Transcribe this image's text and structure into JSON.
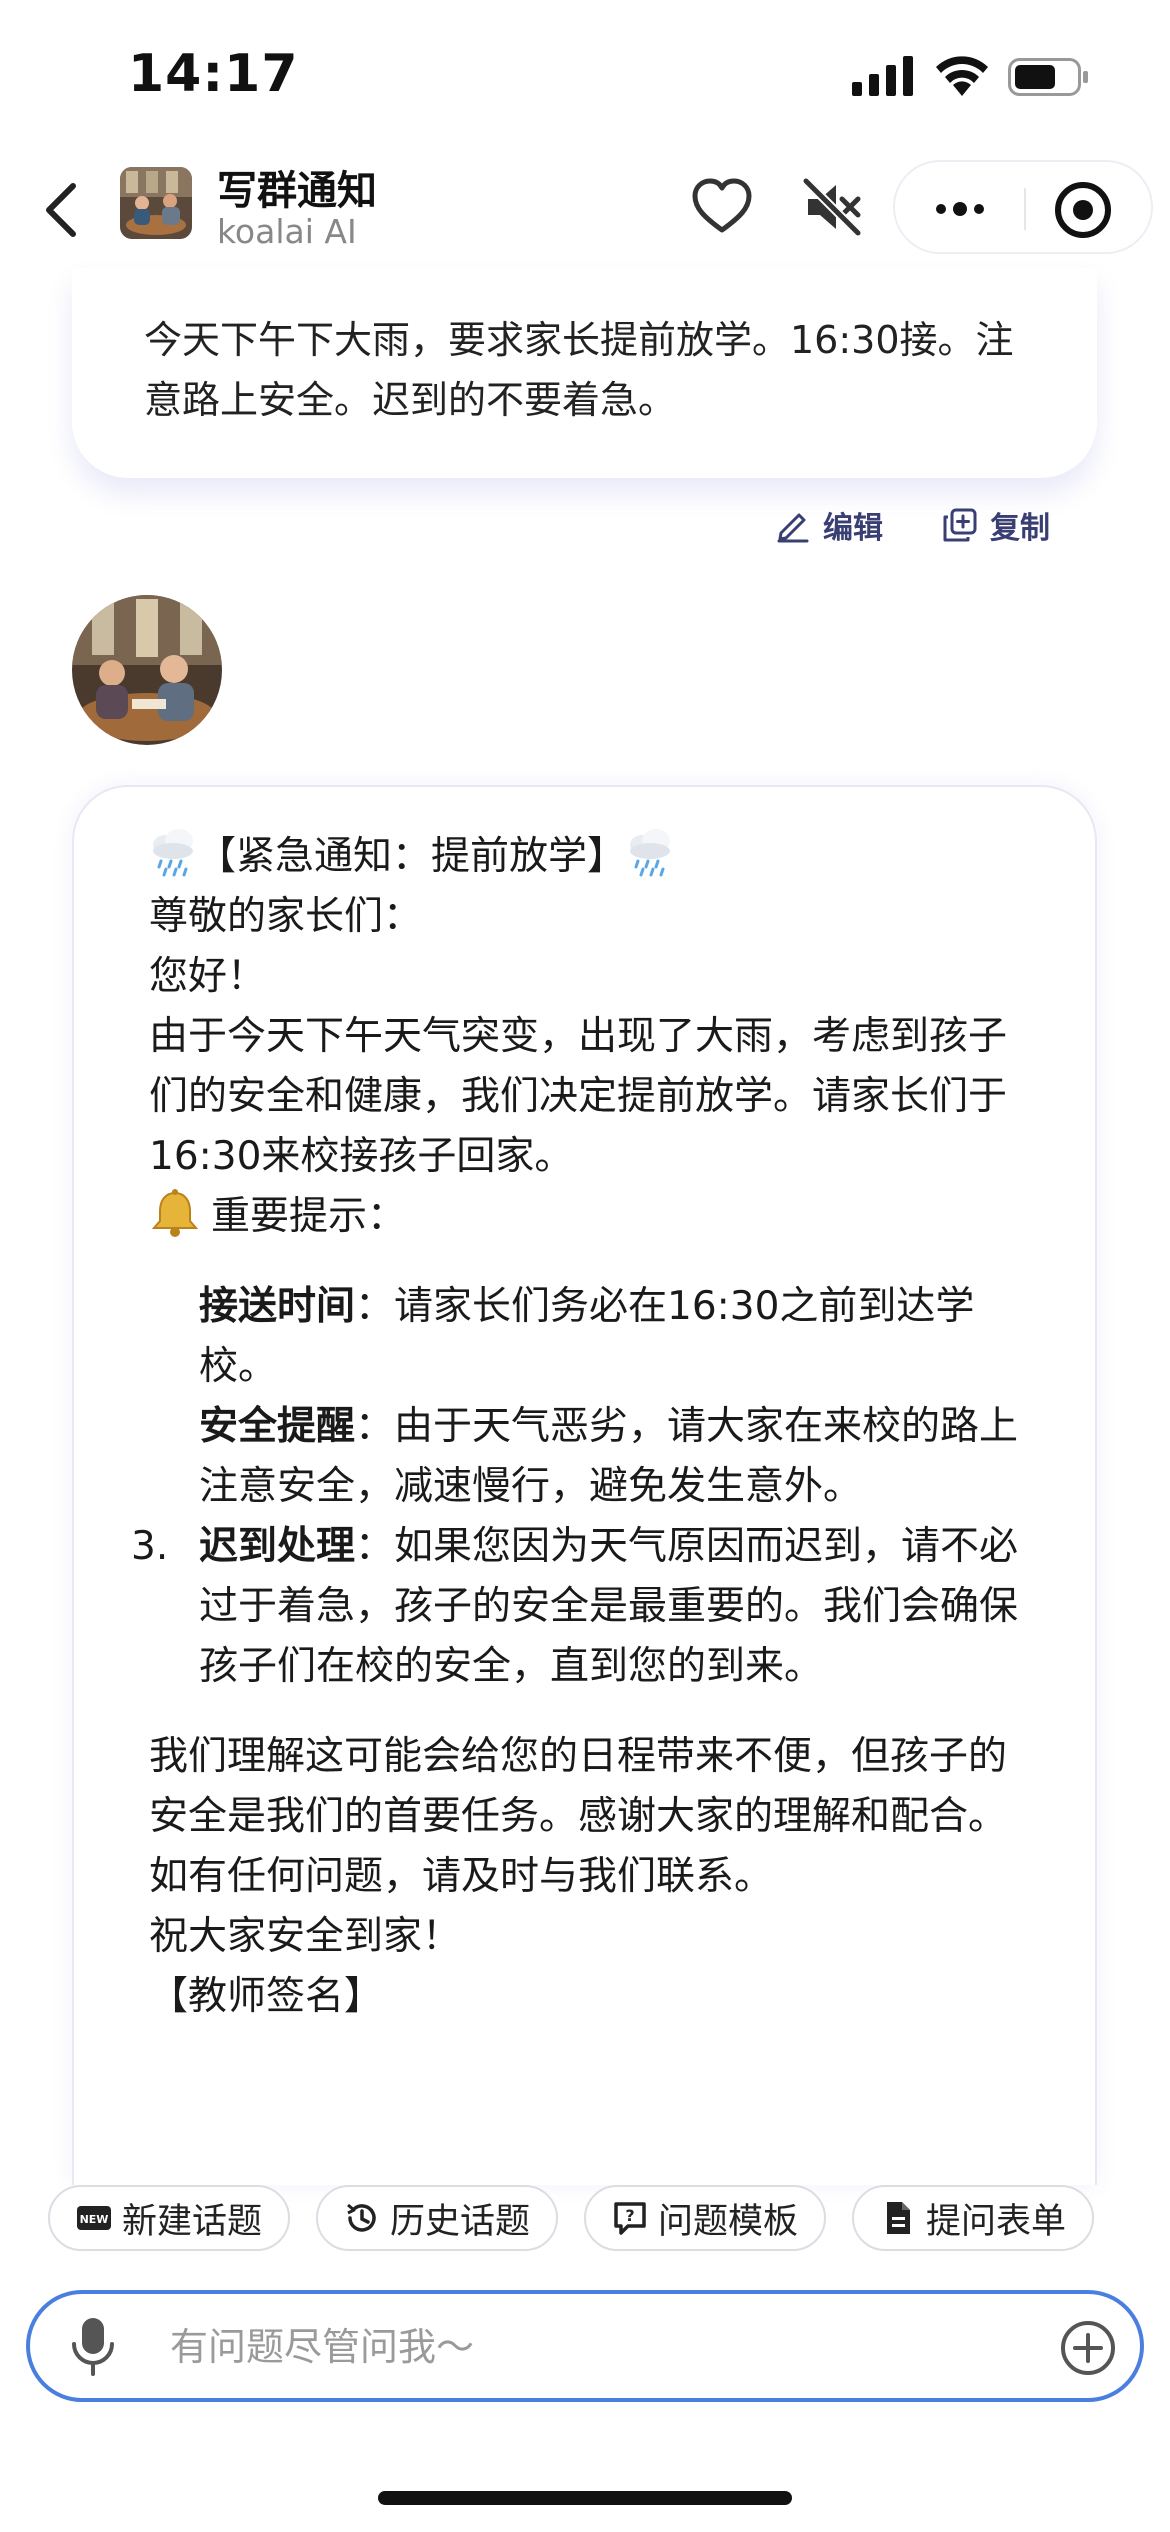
{
  "status_bar": {
    "time": "14:17"
  },
  "nav": {
    "title": "写群通知",
    "subtitle": "koalai AI"
  },
  "user_message": {
    "text": "今天下午下大雨，要求家长提前放学。16:30接。注意路上安全。迟到的不要着急。",
    "edit_label": "编辑",
    "copy_label": "复制"
  },
  "bot_message": {
    "title": "【紧急通知：提前放学】",
    "greeting": "尊敬的家长们：",
    "hello": "您好！",
    "intro": "由于今天下午天气突变，出现了大雨，考虑到孩子们的安全和健康，我们决定提前放学。请家长们于16:30来校接孩子回家。",
    "tips_heading": "重要提示：",
    "items": [
      {
        "number": "",
        "title": "接送时间",
        "text": "：请家长们务必在16:30之前到达学校。"
      },
      {
        "number": "",
        "title": "安全提醒",
        "text": "：由于天气恶劣，请大家在来校的路上注意安全，减速慢行，避免发生意外。"
      },
      {
        "number": "3.",
        "title": "迟到处理",
        "text": "：如果您因为天气原因而迟到，请不必过于着急，孩子的安全是最重要的。我们会确保孩子们在校的安全，直到您的到来。"
      }
    ],
    "closing": "我们理解这可能会给您的日程带来不便，但孩子的安全是我们的首要任务。感谢大家的理解和配合。",
    "contact": "如有任何问题，请及时与我们联系。",
    "wish": "祝大家安全到家！",
    "signature": "【教师签名】"
  },
  "quick_actions": [
    {
      "label": "新建话题",
      "icon": "new-badge-icon"
    },
    {
      "label": "历史话题",
      "icon": "history-icon"
    },
    {
      "label": "问题模板",
      "icon": "question-template-icon"
    },
    {
      "label": "提问表单",
      "icon": "document-icon"
    }
  ],
  "input": {
    "placeholder": "有问题尽管问我～",
    "value": ""
  },
  "colors": {
    "accent": "#4a7fe0",
    "action_text": "#3a3f73",
    "bubble_shadow": "#565ac8"
  }
}
